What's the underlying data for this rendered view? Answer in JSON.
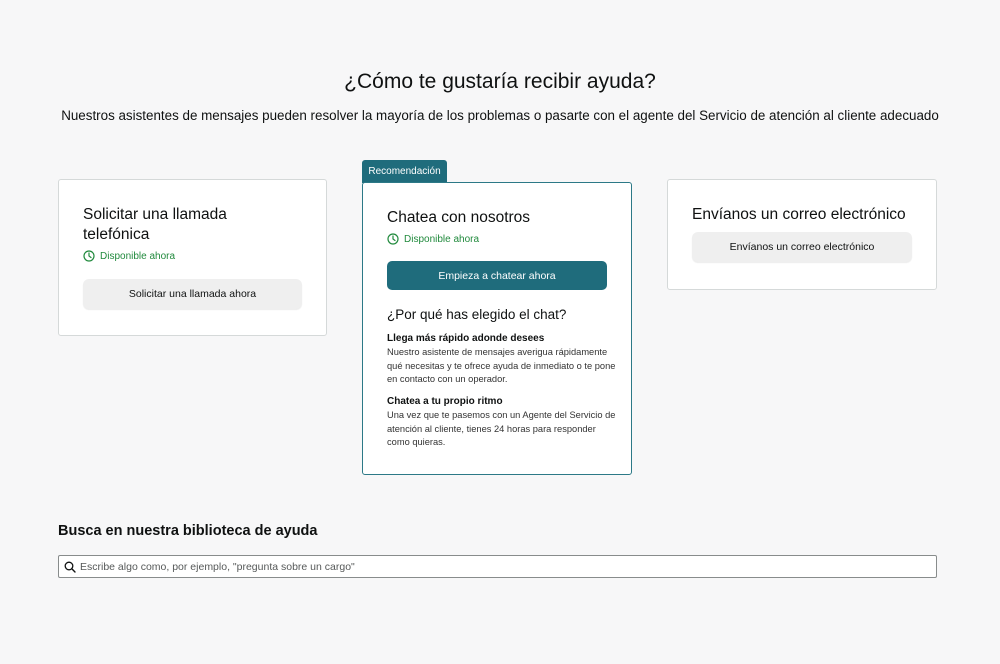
{
  "header": {
    "title": "¿Cómo te gustaría recibir ayuda?",
    "subtitle": "Nuestros asistentes de mensajes pueden resolver la mayoría de los problemas o pasarte con el agente del Servicio de atención al cliente adecuado"
  },
  "phone_card": {
    "title": "Solicitar una llamada telefónica",
    "availability": "Disponible ahora",
    "button_label": "Solicitar una llamada ahora"
  },
  "chat_card": {
    "badge": "Recomendación",
    "title": "Chatea con nosotros",
    "availability": "Disponible ahora",
    "button_label": "Empieza a chatear ahora",
    "why_title": "¿Por qué has elegido el chat?",
    "reasons": [
      {
        "title": "Llega más rápido adonde desees",
        "text": "Nuestro asistente de mensajes averigua rápidamente qué necesitas y te ofrece ayuda de inmediato o te pone en contacto con un operador."
      },
      {
        "title": "Chatea a tu propio ritmo",
        "text": "Una vez que te pasemos con un Agente del Servicio de atención al cliente, tienes 24 horas para responder como quieras."
      }
    ]
  },
  "email_card": {
    "title": "Envíanos un correo electrónico",
    "button_label": "Envíanos un correo electrónico"
  },
  "search": {
    "title": "Busca en nuestra biblioteca de ayuda",
    "placeholder": "Escribe algo como, por ejemplo, \"pregunta sobre un cargo\""
  },
  "colors": {
    "accent": "#1f6c7c",
    "available": "#218a3d",
    "background": "#f7f7f8"
  },
  "icons": {
    "availability": "clock-icon",
    "search": "search-icon"
  }
}
